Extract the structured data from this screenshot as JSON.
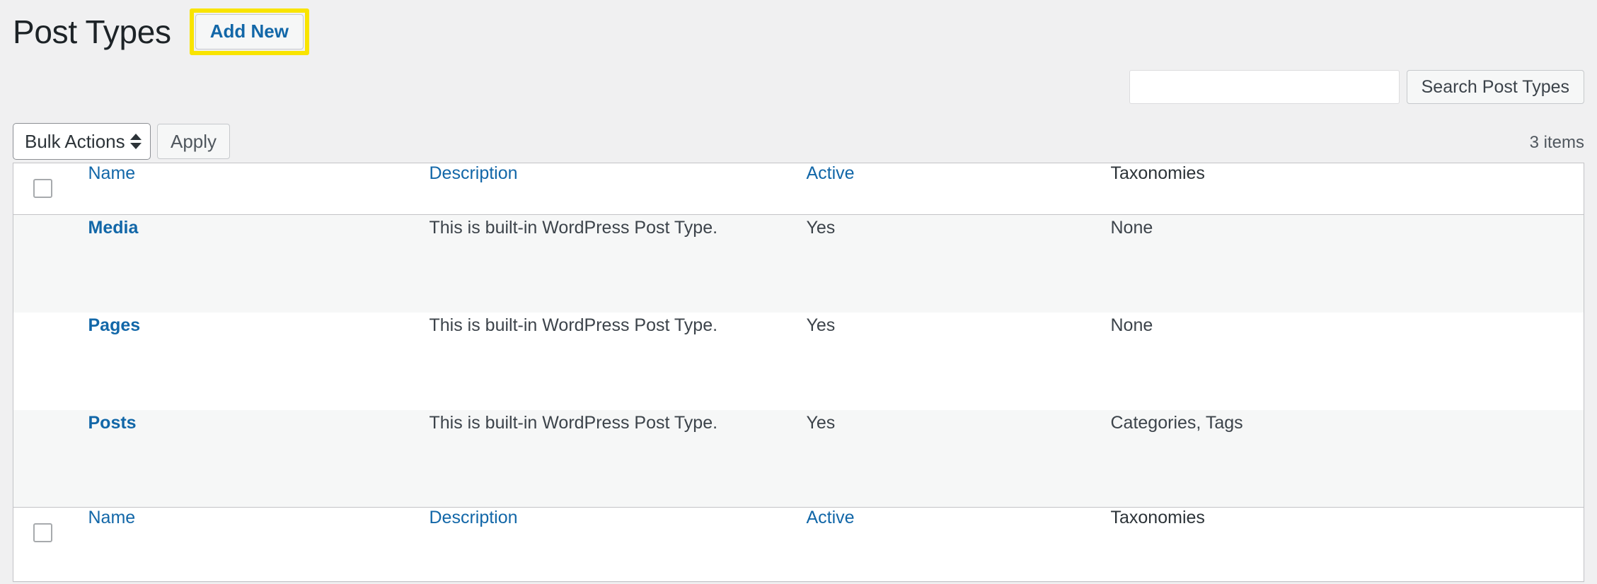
{
  "header": {
    "title": "Post Types",
    "add_new_label": "Add New"
  },
  "search": {
    "value": "",
    "placeholder": "",
    "submit_label": "Search Post Types"
  },
  "tablenav": {
    "bulk_actions_label": "Bulk Actions",
    "apply_label": "Apply",
    "items_count": "3 items"
  },
  "table": {
    "columns": [
      {
        "key": "cb",
        "label": "",
        "sortable": false
      },
      {
        "key": "name",
        "label": "Name",
        "sortable": true
      },
      {
        "key": "desc",
        "label": "Description",
        "sortable": true
      },
      {
        "key": "active",
        "label": "Active",
        "sortable": true
      },
      {
        "key": "tax",
        "label": "Taxonomies",
        "sortable": false
      }
    ],
    "rows": [
      {
        "name": "Media",
        "description": "This is built-in WordPress Post Type.",
        "active": "Yes",
        "taxonomies": "None"
      },
      {
        "name": "Pages",
        "description": "This is built-in WordPress Post Type.",
        "active": "Yes",
        "taxonomies": "None"
      },
      {
        "name": "Posts",
        "description": "This is built-in WordPress Post Type.",
        "active": "Yes",
        "taxonomies": "Categories, Tags"
      }
    ]
  },
  "colors": {
    "link": "#1267a8",
    "highlight": "#f9e400",
    "page_bg": "#f0f0f1",
    "row_alt": "#f6f7f7",
    "text": "#3c434a"
  }
}
